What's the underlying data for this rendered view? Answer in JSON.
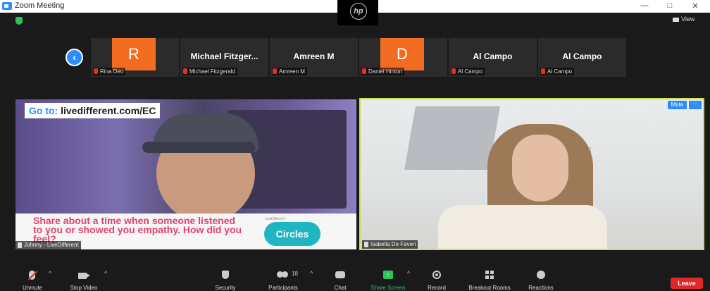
{
  "window": {
    "title": "Zoom Meeting",
    "controls": {
      "minimize": "—",
      "maximize": "□",
      "close": "✕"
    },
    "camera_logo": "hp"
  },
  "view_label": "View",
  "participants_strip": [
    {
      "type": "avatar",
      "initial": "R",
      "caption": "Rina Deo",
      "avatar_color": "#f26d21"
    },
    {
      "type": "name",
      "display": "Michael  Fitzger...",
      "caption": "Michael Fitzgerald"
    },
    {
      "type": "name",
      "display": "Amreen M",
      "caption": "Amreen M"
    },
    {
      "type": "avatar",
      "initial": "D",
      "caption": "Daniel Hinton",
      "avatar_color": "#f26d21"
    },
    {
      "type": "name",
      "display": "Al Campo",
      "caption": "Al Campo"
    },
    {
      "type": "name",
      "display": "Al Campo",
      "caption": "Al Campo"
    }
  ],
  "main_video_left": {
    "goto_prefix": "Go to: ",
    "goto_url": "livedifferent.com/EC",
    "banner_text": "Share about a time when someone listened to you or showed you empathy. How did you feel?",
    "circles_brand": "LiveDifferent",
    "circles_label": "Circles",
    "name": "Johnny - LiveDifferent"
  },
  "main_video_right": {
    "name": "Isabella De Faveri",
    "mute_label": "Mute",
    "more_label": "···",
    "active_speaker_color": "#c6e34e"
  },
  "toolbar": {
    "unmute": "Unmute",
    "stop_video": "Stop Video",
    "security": "Security",
    "participants": "Participants",
    "participants_count": "18",
    "chat": "Chat",
    "share_screen": "Share Screen",
    "record": "Record",
    "breakout_rooms": "Breakout Rooms",
    "reactions": "Reactions",
    "leave": "Leave"
  },
  "colors": {
    "accent": "#2d8cff",
    "share_green": "#2fc25b",
    "leave_red": "#e02828"
  }
}
